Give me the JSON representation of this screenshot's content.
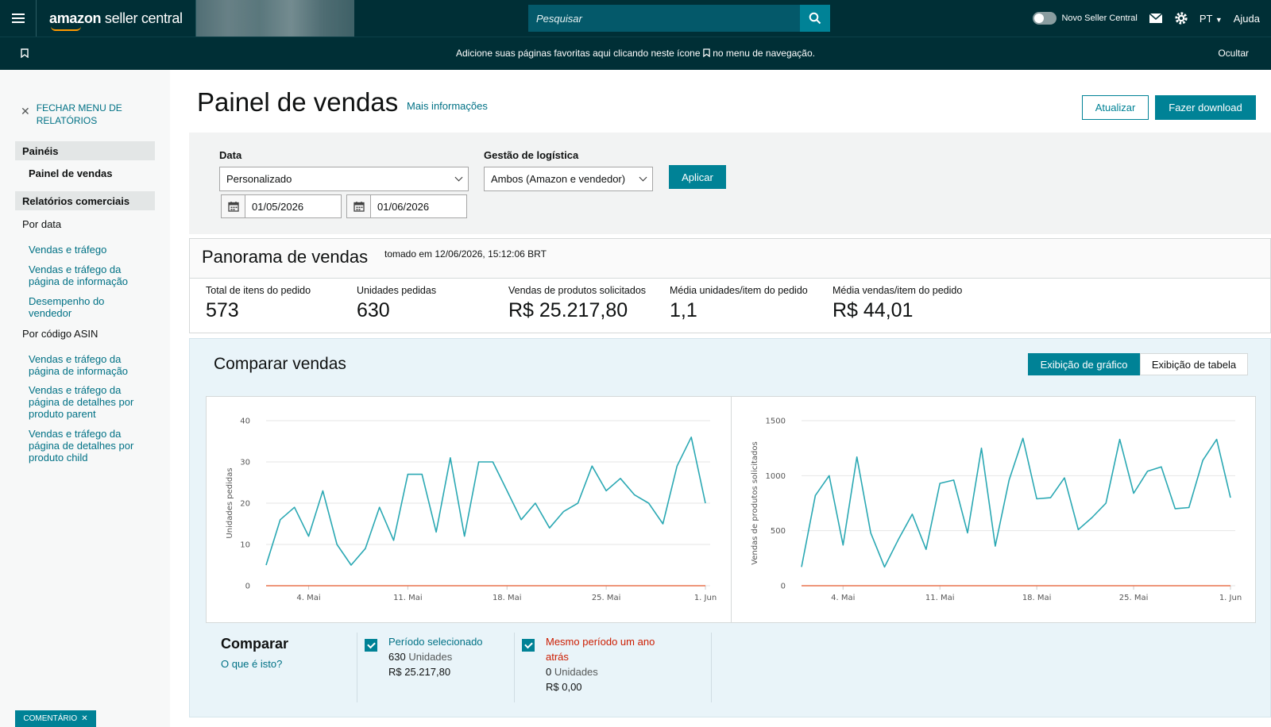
{
  "topbar": {
    "logo_brand": "amazon",
    "logo_text": " seller central",
    "search_placeholder": "Pesquisar",
    "novo_label": "Novo Seller Central",
    "lang": "PT",
    "help": "Ajuda"
  },
  "favbar": {
    "message_part1": "Adicione suas páginas favoritas aqui clicando neste ícone",
    "message_part2": "no menu de navegação.",
    "hide": "Ocultar"
  },
  "sidebar": {
    "close_menu": "FECHAR MENU DE RELATÓRIOS",
    "section_paineis": "Painéis",
    "painel_vendas": "Painel de vendas",
    "section_relatorios": "Relatórios comerciais",
    "por_data": "Por data",
    "link_1": "Vendas e tráfego",
    "link_2": "Vendas e tráfego da página de informação",
    "link_3": "Desempenho do vendedor",
    "por_asin": "Por código ASIN",
    "link_4": "Vendas e tráfego da página de informação",
    "link_5": "Vendas e tráfego da página de detalhes por produto parent",
    "link_6": "Vendas e tráfego da página de detalhes por produto child",
    "comment": "COMENTÁRIO"
  },
  "header": {
    "title": "Painel de vendas",
    "more_info": "Mais informações",
    "refresh": "Atualizar",
    "download": "Fazer download"
  },
  "filters": {
    "date_label": "Data",
    "date_select": "Personalizado",
    "start_date": "01/05/2026",
    "end_date": "01/06/2026",
    "logistics_label": "Gestão de logística",
    "logistics_select": "Ambos (Amazon e vendedor)",
    "apply": "Aplicar"
  },
  "panorama": {
    "title": "Panorama de vendas",
    "taken_at": "tomado em 12/06/2026, 15:12:06 BRT",
    "metrics": [
      {
        "label": "Total de itens do pedido",
        "value": "573"
      },
      {
        "label": "Unidades pedidas",
        "value": "630"
      },
      {
        "label": "Vendas de produtos solicitados",
        "value": "R$ 25.217,80"
      },
      {
        "label": "Média unidades/item do pedido",
        "value": "1,1"
      },
      {
        "label": "Média vendas/item do pedido",
        "value": "R$ 44,01"
      }
    ]
  },
  "compare": {
    "title": "Comparar vendas",
    "tab_graph": "Exibição de gráfico",
    "tab_table": "Exibição de tabela",
    "label": "Comparar",
    "what": "O que é isto?",
    "period1_title": "Período selecionado",
    "period1_units_value": "630",
    "period1_units_word": "Unidades",
    "period1_sales": "R$ 25.217,80",
    "period2_title": "Mesmo período um ano atrás",
    "period2_units_value": "0",
    "period2_units_word": "Unidades",
    "period2_sales": "R$ 0,00"
  },
  "colors": {
    "series_current": "#2aa8b3",
    "series_previous": "#e8734e",
    "accent": "#008296"
  },
  "chart_data": [
    {
      "type": "line",
      "ylabel": "Unidades pedidas",
      "xlabel": "",
      "ylim": [
        0,
        40
      ],
      "yticks": [
        0,
        10,
        20,
        30,
        40
      ],
      "x_tick_labels": [
        "4. Mai",
        "11. Mai",
        "18. Mai",
        "25. Mai",
        "1. Jun"
      ],
      "x_tick_index": [
        3,
        10,
        17,
        24,
        31
      ],
      "grid": true,
      "series": [
        {
          "values": [
            5,
            16,
            19,
            12,
            23,
            10,
            5,
            9,
            19,
            11,
            27,
            27,
            13,
            31,
            12,
            30,
            30,
            23,
            16,
            20,
            14,
            18,
            20,
            29,
            23,
            26,
            22,
            20,
            15,
            29,
            36,
            20
          ],
          "color": "#2aa8b3"
        },
        {
          "values": [
            0,
            0,
            0,
            0,
            0,
            0,
            0,
            0,
            0,
            0,
            0,
            0,
            0,
            0,
            0,
            0,
            0,
            0,
            0,
            0,
            0,
            0,
            0,
            0,
            0,
            0,
            0,
            0,
            0,
            0,
            0,
            0
          ],
          "color": "#e8734e"
        }
      ]
    },
    {
      "type": "line",
      "ylabel": "Vendas de produtos solicitados",
      "xlabel": "",
      "ylim": [
        0,
        1500
      ],
      "yticks": [
        0,
        500,
        1000,
        1500
      ],
      "x_tick_labels": [
        "4. Mai",
        "11. Mai",
        "18. Mai",
        "25. Mai",
        "1. Jun"
      ],
      "x_tick_index": [
        3,
        10,
        17,
        24,
        31
      ],
      "grid": true,
      "series": [
        {
          "values": [
            170,
            820,
            1000,
            370,
            1170,
            480,
            170,
            420,
            650,
            330,
            930,
            960,
            480,
            1250,
            360,
            960,
            1340,
            790,
            800,
            980,
            510,
            620,
            750,
            1330,
            840,
            1040,
            1080,
            700,
            710,
            1140,
            1330,
            800
          ],
          "color": "#2aa8b3"
        },
        {
          "values": [
            0,
            0,
            0,
            0,
            0,
            0,
            0,
            0,
            0,
            0,
            0,
            0,
            0,
            0,
            0,
            0,
            0,
            0,
            0,
            0,
            0,
            0,
            0,
            0,
            0,
            0,
            0,
            0,
            0,
            0,
            0,
            0
          ],
          "color": "#e8734e"
        }
      ]
    }
  ]
}
